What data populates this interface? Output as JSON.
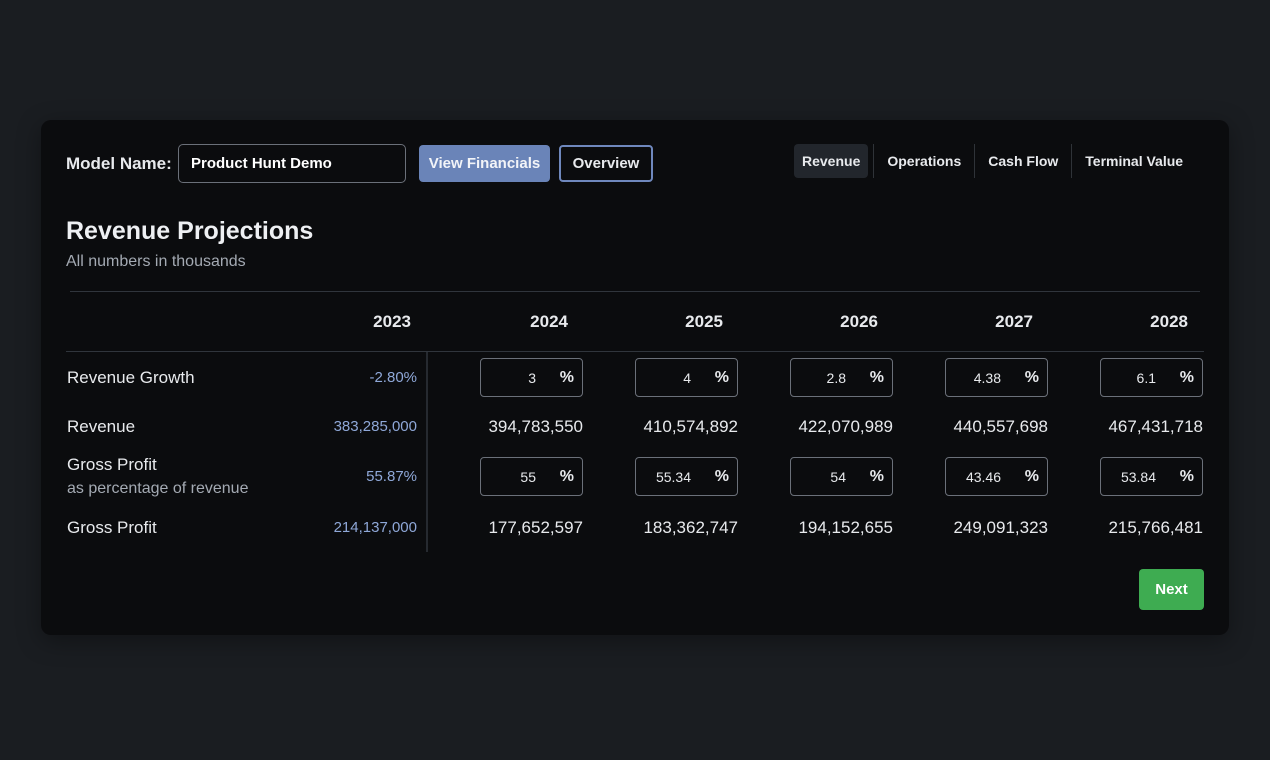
{
  "header": {
    "model_label": "Model Name:",
    "model_name_value": "Product Hunt Demo",
    "view_financials_label": "View Financials",
    "overview_label": "Overview"
  },
  "tabs": [
    {
      "label": "Revenue",
      "active": true
    },
    {
      "label": "Operations",
      "active": false
    },
    {
      "label": "Cash Flow",
      "active": false
    },
    {
      "label": "Terminal Value",
      "active": false
    }
  ],
  "main": {
    "title": "Revenue Projections",
    "subtitle": "All numbers in thousands"
  },
  "table": {
    "years": [
      "2023",
      "2024",
      "2025",
      "2026",
      "2027",
      "2028"
    ],
    "revenue_growth": {
      "label": "Revenue Growth",
      "base": "-2.80%",
      "inputs": [
        "3",
        "4",
        "2.8",
        "4.38",
        "6.1"
      ],
      "unit": "%"
    },
    "revenue": {
      "label": "Revenue",
      "base": "383,285,000",
      "values": [
        "394,783,550",
        "410,574,892",
        "422,070,989",
        "440,557,698",
        "467,431,718"
      ]
    },
    "gross_profit_pct": {
      "label": "Gross Profit",
      "sublabel": "as percentage of revenue",
      "base": "55.87%",
      "inputs": [
        "55",
        "55.34",
        "54",
        "43.46",
        "53.84"
      ],
      "unit": "%"
    },
    "gross_profit": {
      "label": "Gross Profit",
      "base": "214,137,000",
      "values": [
        "177,652,597",
        "183,362,747",
        "194,152,655",
        "249,091,323",
        "215,766,481"
      ]
    }
  },
  "footer": {
    "next_label": "Next"
  },
  "colors": {
    "page_bg": "#1a1d21",
    "card_bg": "#0b0c0e",
    "accent_blue": "#6a84b8",
    "base_value_blue": "#8fa8d8",
    "next_green": "#3eac51"
  }
}
